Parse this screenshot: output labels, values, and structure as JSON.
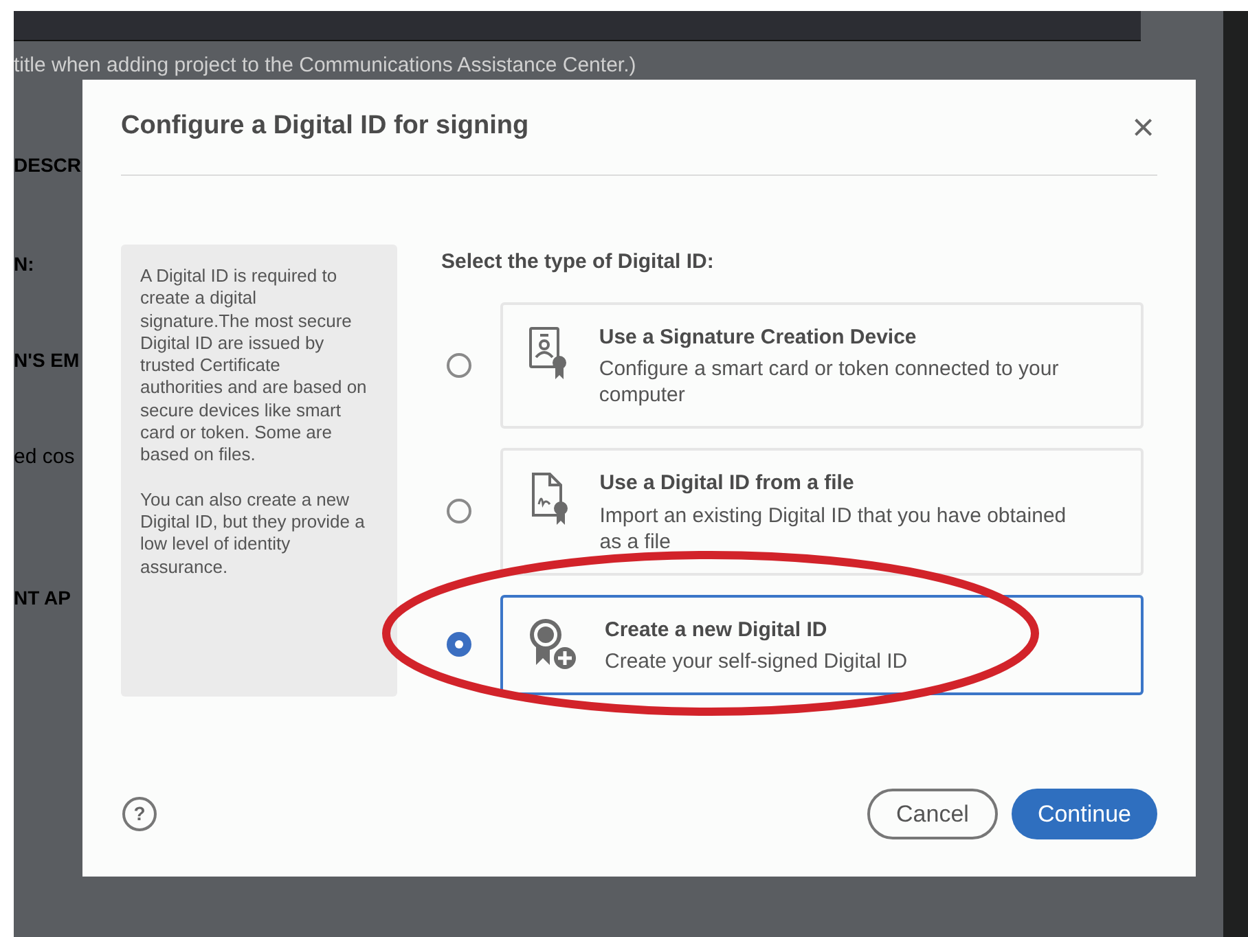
{
  "background": {
    "texts": [
      "title when adding project to the Communications Assistance Center.)",
      "DESCR",
      "N:",
      "N'S EM",
      "ed cos",
      "NT AP"
    ]
  },
  "dialog": {
    "title": "Configure a Digital ID for signing",
    "close": "×",
    "info": [
      "A Digital ID is required to create a digital signature.The most secure Digital ID are issued by trusted Certificate authorities and are based on secure devices like smart card or token. Some are based on files.",
      "You can also create a new Digital ID, but they provide a low level of identity assurance."
    ],
    "heading": "Select the type of Digital ID:",
    "options": [
      {
        "kind": "device",
        "title": "Use a Signature Creation Device",
        "description": "Configure a smart card or token connected to your computer",
        "selected": false
      },
      {
        "kind": "file",
        "title": "Use a Digital ID from a file",
        "description": "Import an existing Digital ID that you have obtained as a file",
        "selected": false
      },
      {
        "kind": "new",
        "title": "Create a new Digital ID",
        "description": "Create your self-signed Digital ID",
        "selected": true
      }
    ],
    "help": "?",
    "buttons": [
      {
        "kind": "secondary",
        "label": "Cancel"
      },
      {
        "kind": "primary",
        "label": "Continue"
      }
    ]
  }
}
